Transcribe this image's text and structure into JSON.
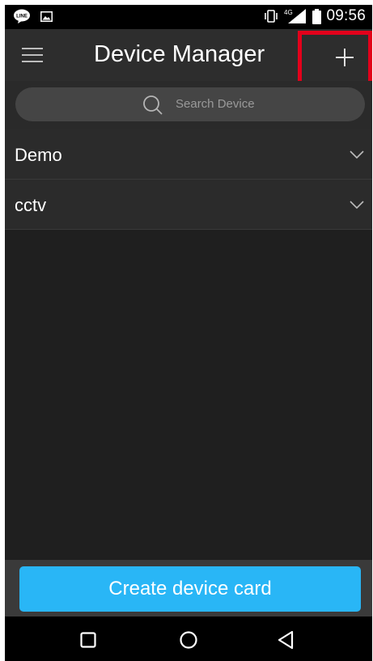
{
  "status_bar": {
    "time": "09:56",
    "network_label": "4G",
    "icons": [
      "line-app-icon",
      "gallery-icon",
      "vibrate-icon",
      "signal-icon",
      "battery-icon"
    ]
  },
  "app_bar": {
    "title": "Device Manager",
    "menu_icon": "hamburger-menu-icon",
    "add_icon": "plus-icon",
    "highlight_color": "#e3001b"
  },
  "search": {
    "placeholder": "Search Device"
  },
  "groups": [
    {
      "label": "Demo",
      "expanded": false
    },
    {
      "label": "cctv",
      "expanded": false
    }
  ],
  "bottom": {
    "create_label": "Create device card",
    "accent": "#29b6f6"
  },
  "nav_bar": {
    "icons": [
      "recents-square-icon",
      "home-circle-icon",
      "back-triangle-icon"
    ]
  }
}
